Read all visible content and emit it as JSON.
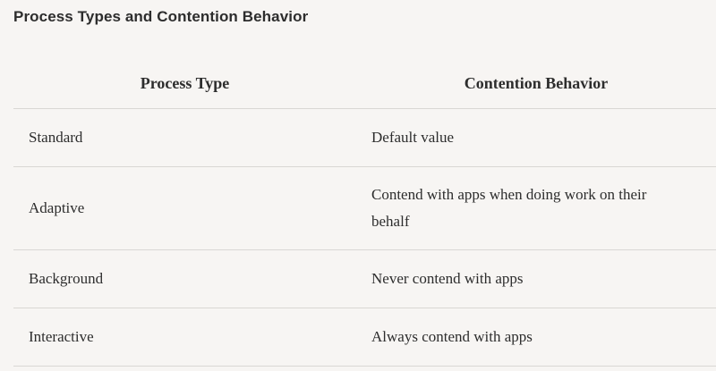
{
  "title": "Process Types and Contention Behavior",
  "table": {
    "headers": [
      "Process Type",
      "Contention Behavior"
    ],
    "rows": [
      {
        "type": "Standard",
        "behavior": "Default value"
      },
      {
        "type": "Adaptive",
        "behavior": "Contend with apps when doing work on their behalf"
      },
      {
        "type": "Background",
        "behavior": "Never contend with apps"
      },
      {
        "type": "Interactive",
        "behavior": "Always contend with apps"
      }
    ]
  }
}
